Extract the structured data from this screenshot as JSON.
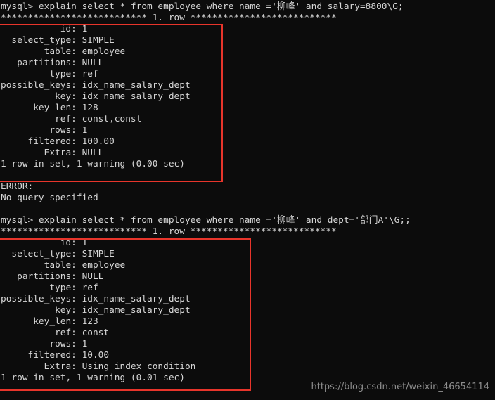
{
  "terminal": {
    "title": "mysql client terminal",
    "background_color": "#0c0c0c",
    "text_color": "#d6d6d6",
    "annotation_color": "#e8352b",
    "prompt": "mysql>",
    "lines": [
      "mysql> explain select * from employee where name ='柳峰' and salary=8800\\G;",
      "*************************** 1. row ***************************",
      "           id: 1",
      "  select_type: SIMPLE",
      "        table: employee",
      "   partitions: NULL",
      "         type: ref",
      "possible_keys: idx_name_salary_dept",
      "          key: idx_name_salary_dept",
      "      key_len: 128",
      "          ref: const,const",
      "         rows: 1",
      "     filtered: 100.00",
      "        Extra: NULL",
      "1 row in set, 1 warning (0.00 sec)",
      "",
      "ERROR:",
      "No query specified",
      "",
      "mysql> explain select * from employee where name ='柳峰' and dept='部门A'\\G;;",
      "*************************** 1. row ***************************",
      "           id: 1",
      "  select_type: SIMPLE",
      "        table: employee",
      "   partitions: NULL",
      "         type: ref",
      "possible_keys: idx_name_salary_dept",
      "          key: idx_name_salary_dept",
      "      key_len: 123",
      "          ref: const",
      "         rows: 1",
      "     filtered: 10.00",
      "        Extra: Using index condition",
      "1 row in set, 1 warning (0.01 sec)"
    ]
  },
  "queries": [
    {
      "command": "explain select * from employee where name ='柳峰' and salary=8800\\G;",
      "explain": {
        "id": "1",
        "select_type": "SIMPLE",
        "table": "employee",
        "partitions": "NULL",
        "type": "ref",
        "possible_keys": "idx_name_salary_dept",
        "key": "idx_name_salary_dept",
        "key_len": "128",
        "ref": "const,const",
        "rows": "1",
        "filtered": "100.00",
        "Extra": "NULL"
      },
      "result_status": "1 row in set, 1 warning (0.00 sec)",
      "error": {
        "label": "ERROR:",
        "message": "No query specified"
      }
    },
    {
      "command": "explain select * from employee where name ='柳峰' and dept='部门A'\\G;;",
      "explain": {
        "id": "1",
        "select_type": "SIMPLE",
        "table": "employee",
        "partitions": "NULL",
        "type": "ref",
        "possible_keys": "idx_name_salary_dept",
        "key": "idx_name_salary_dept",
        "key_len": "123",
        "ref": "const",
        "rows": "1",
        "filtered": "10.00",
        "Extra": "Using index condition"
      },
      "result_status": "1 row in set, 1 warning (0.01 sec)"
    }
  ],
  "watermark": {
    "text": "https://blog.csdn.net/weixin_46654114"
  }
}
